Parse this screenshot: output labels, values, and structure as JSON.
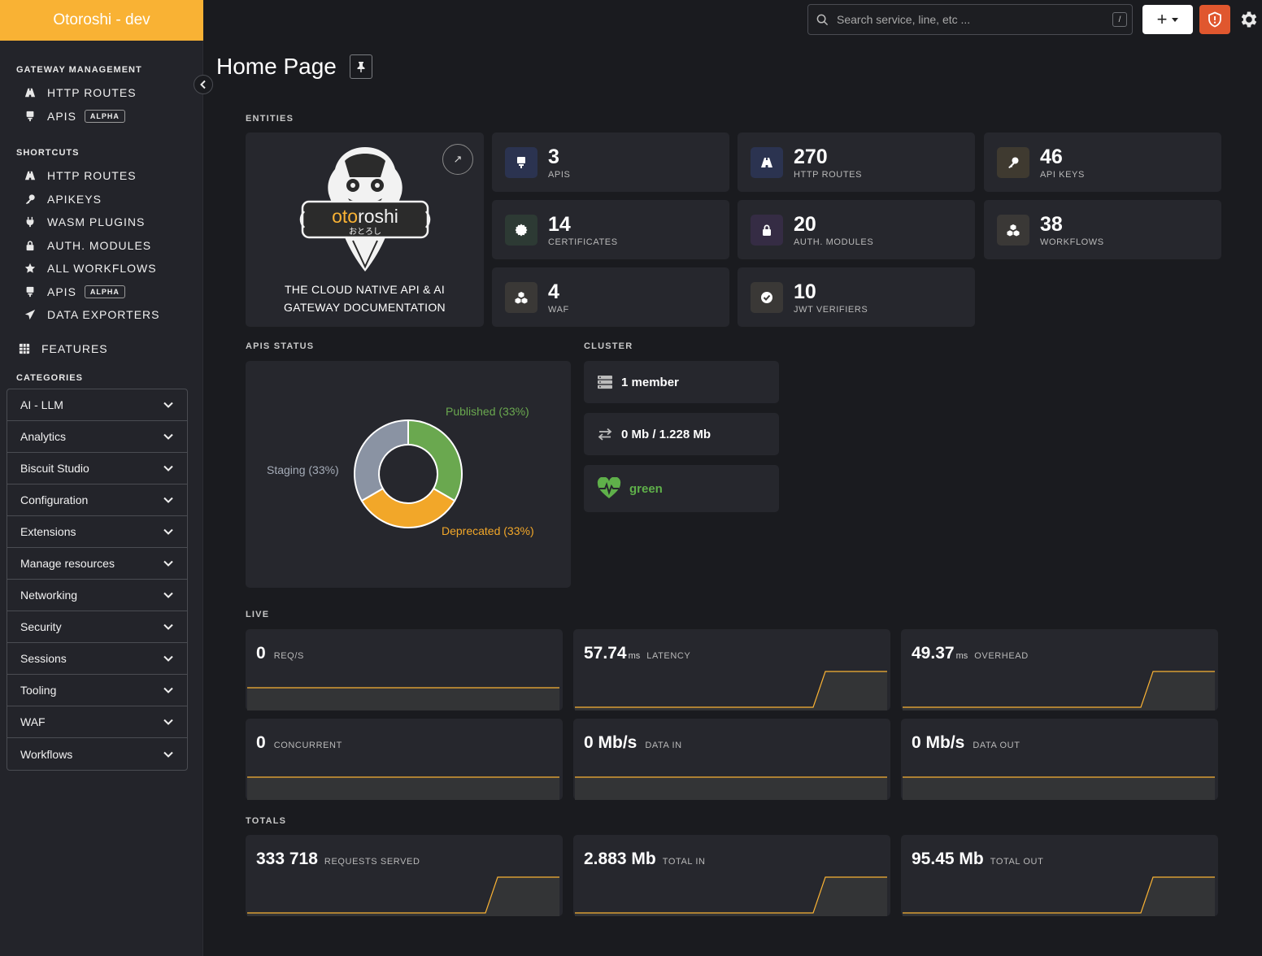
{
  "brand": "Otoroshi - dev",
  "search": {
    "placeholder": "Search service, line, etc ...",
    "shortcut": "/"
  },
  "header": {
    "add_label": "+"
  },
  "sidebar": {
    "gateway_title": "GATEWAY MANAGEMENT",
    "gateway_items": [
      {
        "label": "HTTP ROUTES",
        "icon": "road-icon"
      },
      {
        "label": "APIS",
        "badge": "ALPHA",
        "icon": "api-icon"
      }
    ],
    "shortcuts_title": "SHORTCUTS",
    "shortcut_items": [
      {
        "label": "HTTP ROUTES",
        "icon": "road-icon"
      },
      {
        "label": "APIKEYS",
        "icon": "key-icon"
      },
      {
        "label": "WASM PLUGINS",
        "icon": "plug-icon"
      },
      {
        "label": "AUTH. MODULES",
        "icon": "lock-icon"
      },
      {
        "label": "ALL WORKFLOWS",
        "icon": "star-icon"
      },
      {
        "label": "APIS",
        "badge": "ALPHA",
        "icon": "api-icon"
      },
      {
        "label": "DATA EXPORTERS",
        "icon": "paper-plane-icon"
      }
    ],
    "features_label": "FEATURES",
    "categories_title": "CATEGORIES",
    "categories": [
      "AI - LLM",
      "Analytics",
      "Biscuit Studio",
      "Configuration",
      "Extensions",
      "Manage resources",
      "Networking",
      "Security",
      "Sessions",
      "Tooling",
      "WAF",
      "Workflows"
    ]
  },
  "main": {
    "title": "Home Page",
    "entities_label": "ENTITIES",
    "logo": {
      "word_a": "oto",
      "word_b": "roshi",
      "kana": "おとろし"
    },
    "doc_line1": "THE CLOUD NATIVE API & AI",
    "doc_line2": "GATEWAY DOCUMENTATION",
    "entities": [
      {
        "value": "3",
        "label": "APIS",
        "icon": "api-icon",
        "color": "#2b3350"
      },
      {
        "value": "270",
        "label": "HTTP ROUTES",
        "icon": "road-icon",
        "color": "#2b3350"
      },
      {
        "value": "46",
        "label": "API KEYS",
        "icon": "key-icon",
        "color": "#3f3a30"
      },
      {
        "value": "14",
        "label": "CERTIFICATES",
        "icon": "certificate-icon",
        "color": "#2d3a34"
      },
      {
        "value": "20",
        "label": "AUTH. MODULES",
        "icon": "lock-icon",
        "color": "#352c44"
      },
      {
        "value": "38",
        "label": "WORKFLOWS",
        "icon": "cubes-icon",
        "color": "#3a3836"
      },
      {
        "value": "4",
        "label": "WAF",
        "icon": "cubes-icon",
        "color": "#3a3836"
      },
      {
        "value": "10",
        "label": "JWT VERIFIERS",
        "icon": "check-circle-icon",
        "color": "#3a3836"
      }
    ],
    "apis_status_label": "APIS STATUS",
    "apis_status": [
      {
        "label": "Published (33%)",
        "value": 33.33,
        "color": "#6aa84f"
      },
      {
        "label": "Deprecated (33%)",
        "value": 33.33,
        "color": "#f2a729"
      },
      {
        "label": "Staging (33%)",
        "value": 33.33,
        "color": "#8a93a3"
      }
    ],
    "cluster_label": "CLUSTER",
    "cluster": {
      "members": "1 member",
      "data": "0 Mb / 1.228 Mb",
      "health": "green",
      "health_color": "#5fb04a"
    },
    "live_label": "LIVE",
    "live": [
      {
        "value": "0",
        "unit": "",
        "caption": "REQ/S",
        "level": 0
      },
      {
        "value": "57.74",
        "unit": "ms",
        "caption": "LATENCY",
        "level": 1
      },
      {
        "value": "49.37",
        "unit": "ms",
        "caption": "OVERHEAD",
        "level": 1
      },
      {
        "value": "0",
        "unit": "",
        "caption": "CONCURRENT",
        "level": 0
      },
      {
        "value": "0 Mb/s",
        "unit": "",
        "caption": "DATA IN",
        "level": 0
      },
      {
        "value": "0 Mb/s",
        "unit": "",
        "caption": "DATA OUT",
        "level": 0
      }
    ],
    "totals_label": "TOTALS",
    "totals": [
      {
        "value": "333 718",
        "caption": "REQUESTS SERVED",
        "level": 1
      },
      {
        "value": "2.883 Mb",
        "caption": "TOTAL IN",
        "level": 1
      },
      {
        "value": "95.45 Mb",
        "caption": "TOTAL OUT",
        "level": 1
      }
    ],
    "accent": "#f9b234"
  }
}
